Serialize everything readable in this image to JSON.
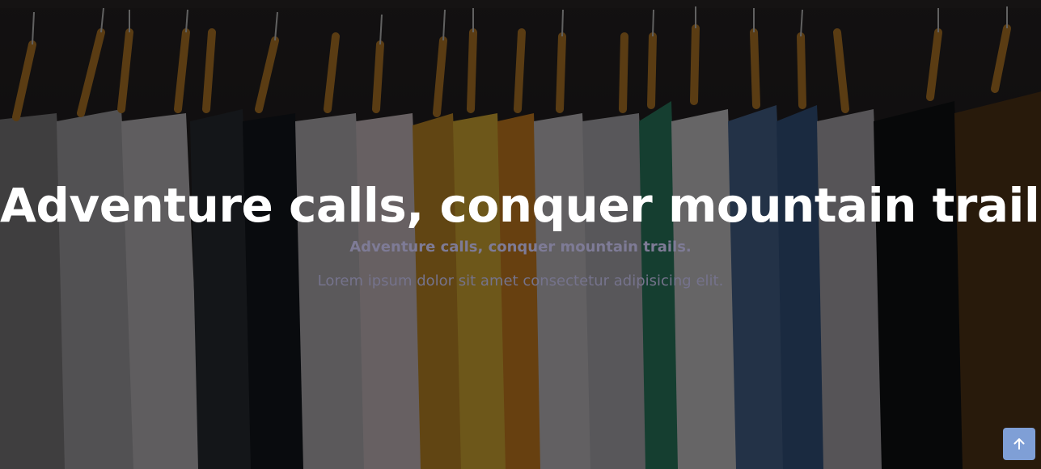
{
  "hero": {
    "title": "Adventure calls, conquer mountain trails.",
    "subtitle": "Adventure calls, conquer mountain trails.",
    "text": "Lorem ipsum dolor sit amet consectetur adipisicing elit."
  },
  "scroll_top": {
    "icon": "arrow-up-icon",
    "color": "#7f9fd6"
  },
  "colors": {
    "overlay": "#000000",
    "title": "#ffffff",
    "subtitle": "#7e7b96",
    "text": "#75738c"
  }
}
